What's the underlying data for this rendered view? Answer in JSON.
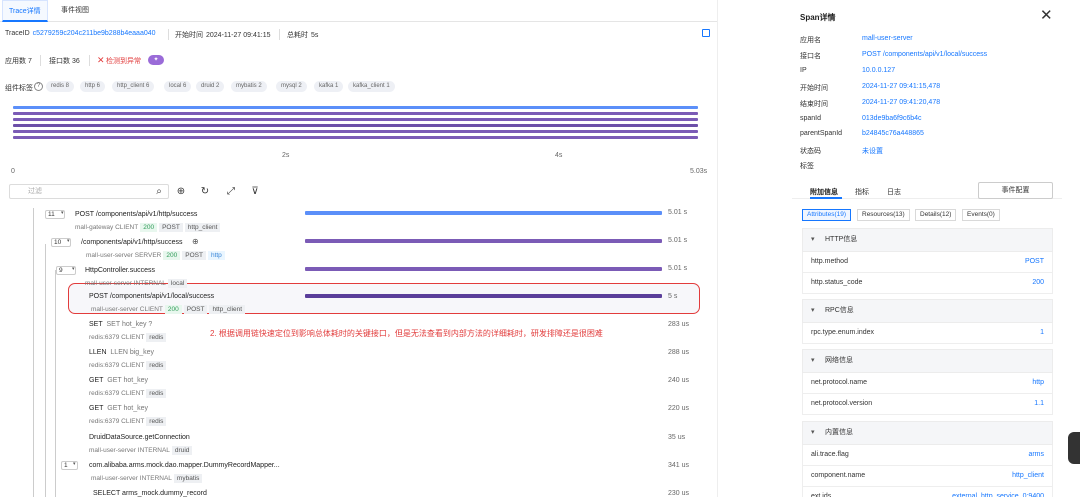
{
  "tabs": [
    "Trace详情",
    "事件视图"
  ],
  "trace": {
    "id_label": "TraceID",
    "id_value": "c5279259c204c211be9b288b4eaaa040",
    "start_label": "开始时间",
    "start_value": "2024-11-27 09:41:15",
    "total_label": "总耗时",
    "total_value": "5s"
  },
  "stats": {
    "apps": "应用数 7",
    "endpoints": "接口数 36",
    "check": "检测到异常"
  },
  "tags": {
    "label": "组件标签",
    "items": [
      "redis 8",
      "http 6",
      "http_client 6",
      "local 6",
      "druid 2",
      "mybatis 2",
      "mysql 2",
      "kafka 1",
      "kafka_client 1"
    ]
  },
  "axis": {
    "top_2s": "2s",
    "top_4s": "4s",
    "b0": "0",
    "b2": "2s",
    "b4": "4s",
    "b5": "5.03s"
  },
  "filter_placeholder": "过滤",
  "colors": {
    "blue": "#5b8ff9",
    "purple": "#7b5bb6",
    "accent": "#1677ff",
    "red": "#e23c3c"
  },
  "spans": [
    {
      "count": "11",
      "name": "POST /components/api/v1/http/success",
      "service": "mall-gateway",
      "kind": "CLIENT",
      "chips": [
        "200",
        "POST",
        "http_client"
      ],
      "dur": "5.01 s",
      "color": "blue"
    },
    {
      "count": "10",
      "name": "/components/api/v1/http/success",
      "service": "mall-user-server",
      "kind": "SERVER",
      "chips": [
        "200",
        "POST",
        "http"
      ],
      "dur": "5.01 s",
      "color": "purple"
    },
    {
      "count": "9",
      "name": "HttpController.success",
      "service": "mall-user-server",
      "kind": "INTERNAL",
      "chips": [
        "local"
      ],
      "dur": "5.01 s",
      "color": "purple"
    },
    {
      "count": "",
      "name": "POST /components/api/v1/local/success",
      "service": "mall-user-server",
      "kind": "CLIENT",
      "chips": [
        "200",
        "POST",
        "http_client"
      ],
      "dur": "5 s",
      "color": "purple"
    },
    {
      "count": "",
      "name": "SET",
      "detail": "SET hot_key ?",
      "service": "redis:6379",
      "kind": "CLIENT",
      "chips": [
        "redis"
      ],
      "dur": "283 us",
      "color": ""
    },
    {
      "count": "",
      "name": "LLEN",
      "detail": "LLEN big_key",
      "service": "redis:6379",
      "kind": "CLIENT",
      "chips": [
        "redis"
      ],
      "dur": "288 us",
      "color": ""
    },
    {
      "count": "",
      "name": "GET",
      "detail": "GET hot_key",
      "service": "redis:6379",
      "kind": "CLIENT",
      "chips": [
        "redis"
      ],
      "dur": "240 us",
      "color": ""
    },
    {
      "count": "",
      "name": "GET",
      "detail": "GET hot_key",
      "service": "redis:6379",
      "kind": "CLIENT",
      "chips": [
        "redis"
      ],
      "dur": "220 us",
      "color": ""
    },
    {
      "count": "",
      "name": "DruidDataSource.getConnection",
      "service": "mall-user-server",
      "kind": "INTERNAL",
      "chips": [
        "druid"
      ],
      "dur": "35 us",
      "color": ""
    },
    {
      "count": "1",
      "name": "com.alibaba.arms.mock.dao.mapper.DummyRecordMapper...",
      "service": "mall-user-server",
      "kind": "INTERNAL",
      "chips": [
        "mybatis"
      ],
      "dur": "341 us",
      "color": ""
    },
    {
      "count": "",
      "name": "SELECT arms_mock.dummy_record",
      "service": "",
      "kind": "",
      "chips": [],
      "dur": "230 us",
      "color": ""
    }
  ],
  "annotation": "2. 根据调用链快速定位到影响总体耗时的关键接口，但是无法查看到内部方法的详细耗时，研发排障还是很困难",
  "panel": {
    "title": "Span详情",
    "fields": [
      {
        "k": "应用名",
        "v": "mall-user-server"
      },
      {
        "k": "接口名",
        "v": "POST /components/api/v1/local/success"
      },
      {
        "k": "IP",
        "v": "10.0.0.127"
      },
      {
        "k": "开始时间",
        "v": "2024-11-27 09:41:15,478"
      },
      {
        "k": "结束时间",
        "v": "2024-11-27 09:41:20,478"
      },
      {
        "k": "spanId",
        "v": "013de9ba6f9c6b4c"
      },
      {
        "k": "parentSpanId",
        "v": "b24845c76a448865"
      },
      {
        "k": "状态码",
        "v": "未设置"
      },
      {
        "k": "标签",
        "v": ""
      }
    ],
    "tabs": [
      "附加信息",
      "指标",
      "日志"
    ],
    "event_button": "事件配置",
    "segments": [
      "Attributes(19)",
      "Resources(13)",
      "Details(12)",
      "Events(0)"
    ],
    "sections": [
      {
        "title": "HTTP信息",
        "attrs": [
          {
            "k": "http.method",
            "v": "POST"
          },
          {
            "k": "http.status_code",
            "v": "200"
          }
        ]
      },
      {
        "title": "RPC信息",
        "attrs": [
          {
            "k": "rpc.type.enum.index",
            "v": "1"
          }
        ]
      },
      {
        "title": "网络信息",
        "attrs": [
          {
            "k": "net.protocol.name",
            "v": "http"
          },
          {
            "k": "net.protocol.version",
            "v": "1.1"
          }
        ]
      },
      {
        "title": "内置信息",
        "attrs": [
          {
            "k": "ali.trace.flag",
            "v": "arms"
          },
          {
            "k": "component.name",
            "v": "http_client"
          },
          {
            "k": "ext.ids",
            "v": "external_http_service_0:9400"
          }
        ]
      }
    ]
  }
}
